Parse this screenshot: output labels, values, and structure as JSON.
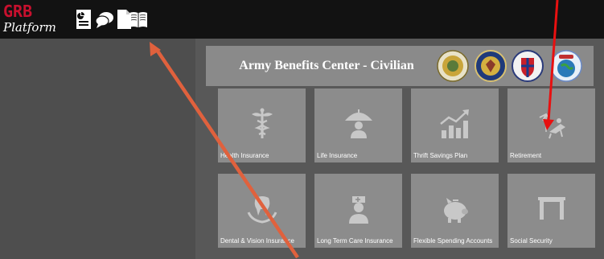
{
  "header": {
    "logo_top": "GRB",
    "logo_bottom": "Platform",
    "icons": [
      "report-icon",
      "chat-icon",
      "document-icon",
      "book-icon"
    ]
  },
  "banner": {
    "title": "Army Benefits Center - Civilian",
    "seals": [
      "army-seal",
      "national-guard-seal",
      "defense-health-seal",
      "dodea-seal"
    ]
  },
  "tiles": [
    {
      "label": "Health Insurance",
      "icon": "caduceus-icon"
    },
    {
      "label": "Life Insurance",
      "icon": "umbrella-person-icon"
    },
    {
      "label": "Thrift Savings Plan",
      "icon": "growth-chart-icon"
    },
    {
      "label": "Retirement",
      "icon": "beach-chair-icon"
    },
    {
      "label": "Dental & Vision Insurance",
      "icon": "tooth-hand-icon"
    },
    {
      "label": "Long Term Care Insurance",
      "icon": "nurse-icon"
    },
    {
      "label": "Flexible Spending Accounts",
      "icon": "piggy-bank-icon"
    },
    {
      "label": "Social Security",
      "icon": "frame-icon"
    }
  ],
  "colors": {
    "topbar": "#121212",
    "logo_red": "#c8102e",
    "tile": "#8c8c8c",
    "banner": "#8a8a8a",
    "annotation_orange": "#e0613d",
    "annotation_red": "#e81010"
  }
}
